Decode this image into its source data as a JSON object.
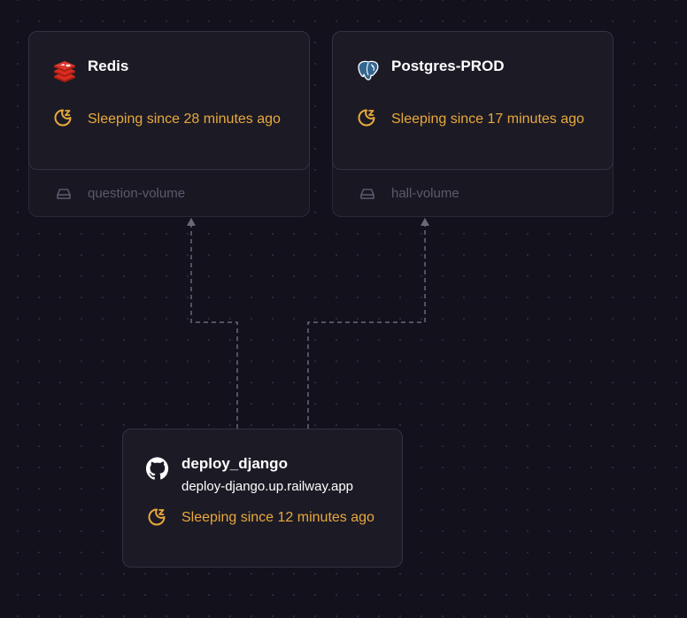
{
  "services": {
    "redis": {
      "name": "Redis",
      "icon": "redis-icon",
      "status": "Sleeping since 28 minutes ago",
      "volume": "question-volume"
    },
    "postgres": {
      "name": "Postgres-PROD",
      "icon": "postgres-elephant-icon",
      "status": "Sleeping since 17 minutes ago",
      "volume": "hall-volume"
    },
    "deploy": {
      "name": "deploy_django",
      "icon": "github-icon",
      "url": "deploy-django.up.railway.app",
      "status": "Sleeping since 12 minutes ago"
    }
  },
  "colors": {
    "background": "#13111c",
    "card": "#1c1a25",
    "sleeping": "#e8a93b",
    "connector": "#6b6878",
    "volume_text": "#5d596b"
  }
}
